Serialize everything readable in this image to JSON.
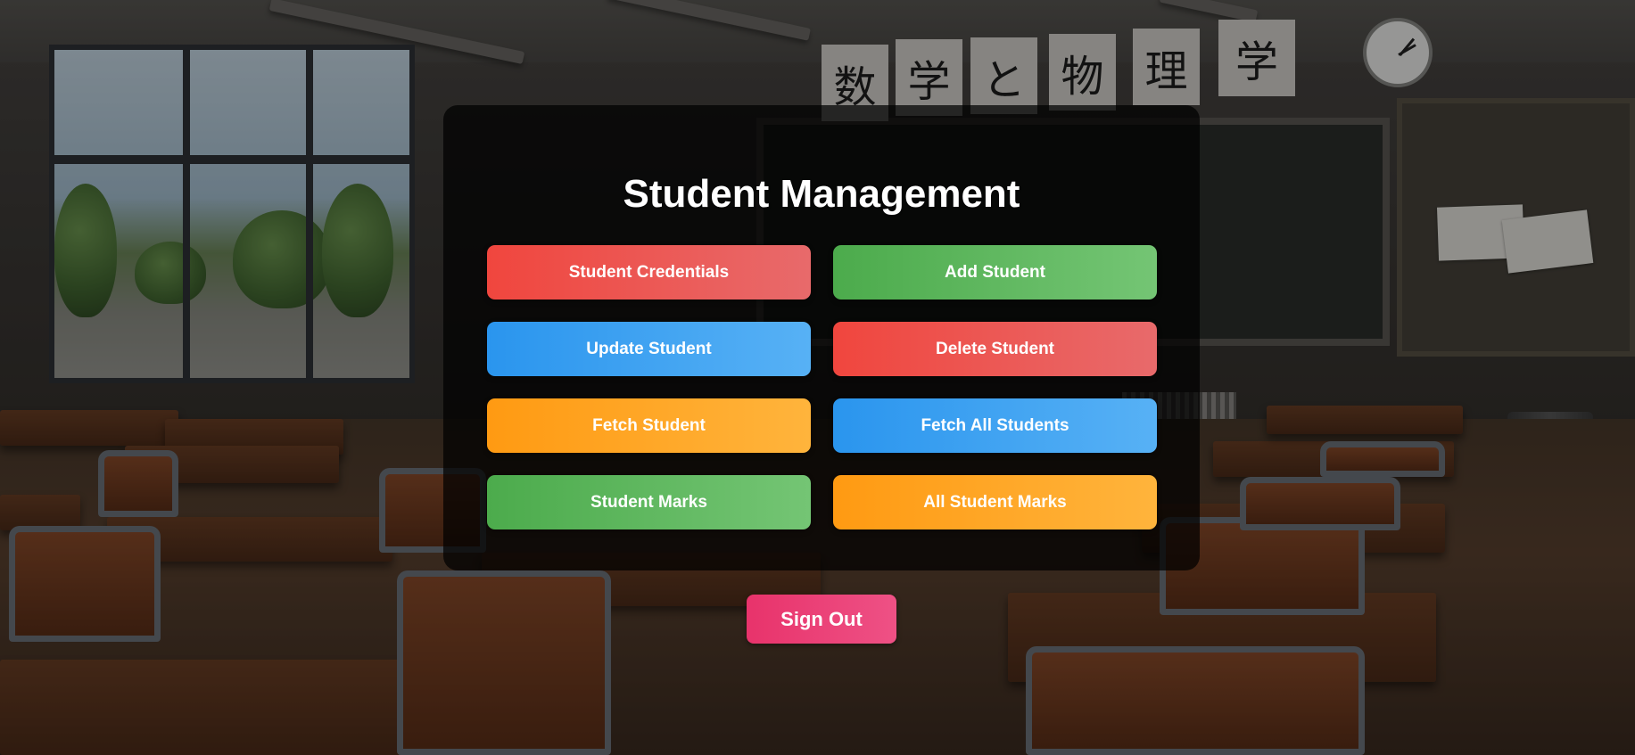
{
  "background": {
    "description_icon": "classroom-background",
    "board_sign_chars": [
      "数",
      "学",
      "と",
      "物",
      "理",
      "学"
    ]
  },
  "panel": {
    "title": "Student Management",
    "buttons": [
      {
        "label": "Student Credentials",
        "color": "#f0463e"
      },
      {
        "label": "Add Student",
        "color": "#4cab4c"
      },
      {
        "label": "Update Student",
        "color": "#2a95ee"
      },
      {
        "label": "Delete Student",
        "color": "#f0463e"
      },
      {
        "label": "Fetch Student",
        "color": "#ff9a12"
      },
      {
        "label": "Fetch All Students",
        "color": "#2a95ee"
      },
      {
        "label": "Student Marks",
        "color": "#4cab4c"
      },
      {
        "label": "All Student Marks",
        "color": "#ff9a12"
      }
    ]
  },
  "sign_out": {
    "label": "Sign Out",
    "color": "#e8336b"
  }
}
